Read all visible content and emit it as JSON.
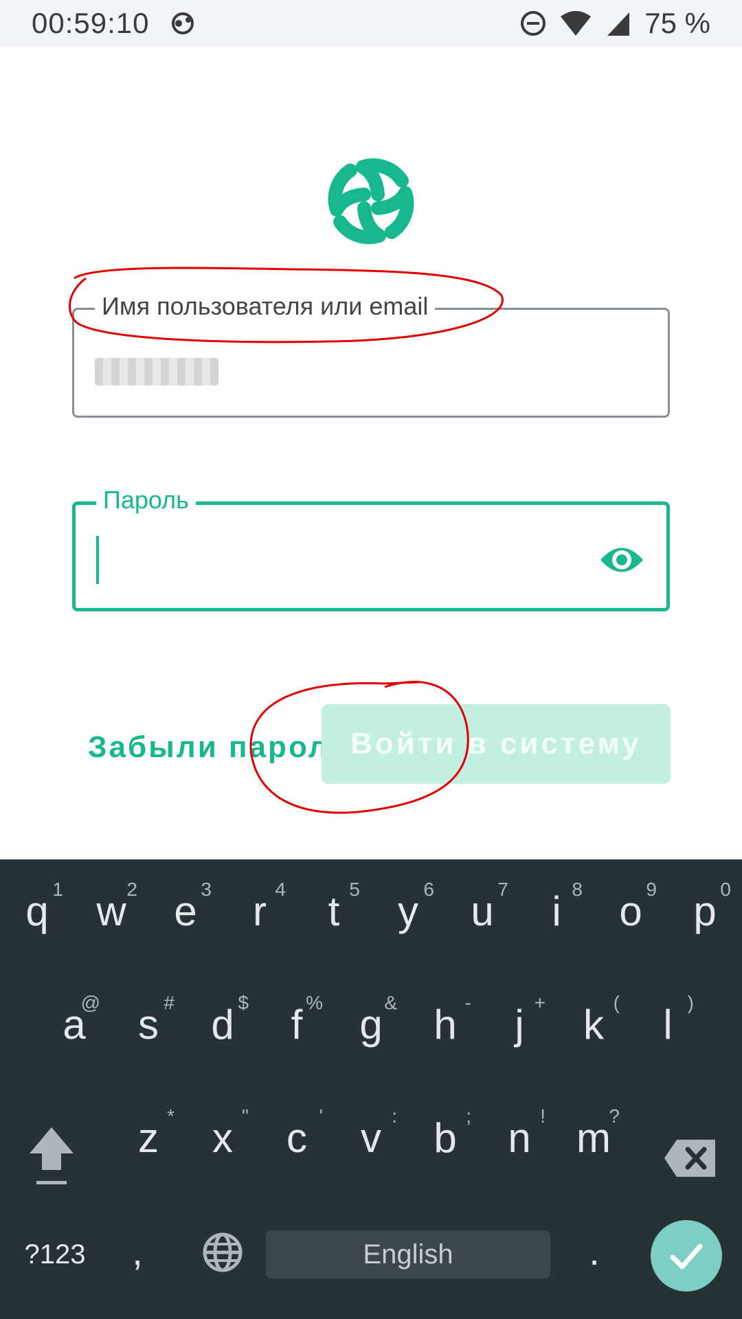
{
  "status_bar": {
    "time": "00:59:10",
    "battery": "75 %"
  },
  "login": {
    "username_label": "Имя пользователя или email",
    "password_label": "Пароль",
    "forgot_password": "Забыли пароль?",
    "login_button": "Войти в систему"
  },
  "keyboard": {
    "row1": [
      {
        "k": "q",
        "h": "1"
      },
      {
        "k": "w",
        "h": "2"
      },
      {
        "k": "e",
        "h": "3"
      },
      {
        "k": "r",
        "h": "4"
      },
      {
        "k": "t",
        "h": "5"
      },
      {
        "k": "y",
        "h": "6"
      },
      {
        "k": "u",
        "h": "7"
      },
      {
        "k": "i",
        "h": "8"
      },
      {
        "k": "o",
        "h": "9"
      },
      {
        "k": "p",
        "h": "0"
      }
    ],
    "row2": [
      {
        "k": "a",
        "h": "@"
      },
      {
        "k": "s",
        "h": "#"
      },
      {
        "k": "d",
        "h": "$"
      },
      {
        "k": "f",
        "h": "%"
      },
      {
        "k": "g",
        "h": "&"
      },
      {
        "k": "h",
        "h": "-"
      },
      {
        "k": "j",
        "h": "+"
      },
      {
        "k": "k",
        "h": "("
      },
      {
        "k": "l",
        "h": ")"
      }
    ],
    "row3": [
      {
        "k": "z",
        "h": "*"
      },
      {
        "k": "x",
        "h": "\""
      },
      {
        "k": "c",
        "h": "'"
      },
      {
        "k": "v",
        "h": ":"
      },
      {
        "k": "b",
        "h": ";"
      },
      {
        "k": "n",
        "h": "!"
      },
      {
        "k": "m",
        "h": "?"
      }
    ],
    "symbols_key": "?123",
    "comma_key": ",",
    "space_label": "English",
    "period_key": "."
  },
  "colors": {
    "accent": "#17b890",
    "keyboard_bg": "#263238",
    "annotation": "#e00000"
  }
}
